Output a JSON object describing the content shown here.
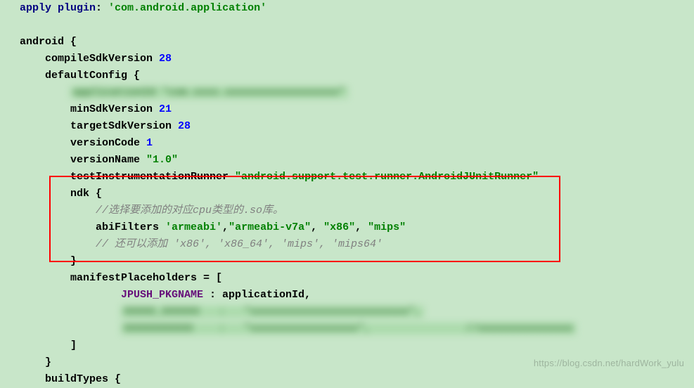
{
  "code": {
    "apply_text": "apply ",
    "plugin_text": "plugin",
    "plugin_colon": ": ",
    "plugin_arg": "'com.android.application'",
    "android_text": "android",
    "compileSdkVersion_text": "compileSdkVersion ",
    "compileSdkVersion_val": "28",
    "defaultConfig_text": "defaultConfig",
    "blurred1": "applicationId \"com.xxxx.xxxxxxxxxxxxxxxxxx\"",
    "minSdkVersion_text": "minSdkVersion ",
    "minSdkVersion_val": "21",
    "targetSdkVersion_text": "targetSdkVersion ",
    "targetSdkVersion_val": "28",
    "versionCode_text": "versionCode ",
    "versionCode_val": "1",
    "versionName_text": "versionName ",
    "versionName_val": "\"1.0\"",
    "testInstrumentationRunner_text": "testInstrumentationRunner ",
    "testInstrumentationRunner_val": "\"android.support.test.runner.AndroidJUnitRunner\"",
    "ndk_text": "ndk",
    "comment1": "//选择要添加的对应cpu类型的.so库。",
    "abiFilters_text": "abiFilters ",
    "abi1": "'armeabi'",
    "comma": ",",
    "abi2": "\"armeabi-v7a\"",
    "abi3": "\"x86\"",
    "abi4": "\"mips\"",
    "comment2": "// 还可以添加 'x86', 'x86_64', 'mips', 'mips64'",
    "manifestPlaceholders_text": "manifestPlaceholders",
    "equals_bracket": " = [",
    "jpush_pkgname": "JPUSH_PKGNAME",
    "colon_app": " : applicationId,",
    "blurred2": "XXXXX_XXXXXX   :   \"xxxxxxxxxxxxxxxxxxxxxxxxx\",",
    "blurred3": "XXXXXXXXXXX    :   \"xxxxxxxxxxxxxxxxx\",               //xxxxxxxxxxxxxxx",
    "close_bracket": "]",
    "close_brace": "}",
    "buildTypes_text": "buildTypes",
    "open_brace": " {"
  },
  "watermark": "https://blog.csdn.net/hardWork_yulu"
}
